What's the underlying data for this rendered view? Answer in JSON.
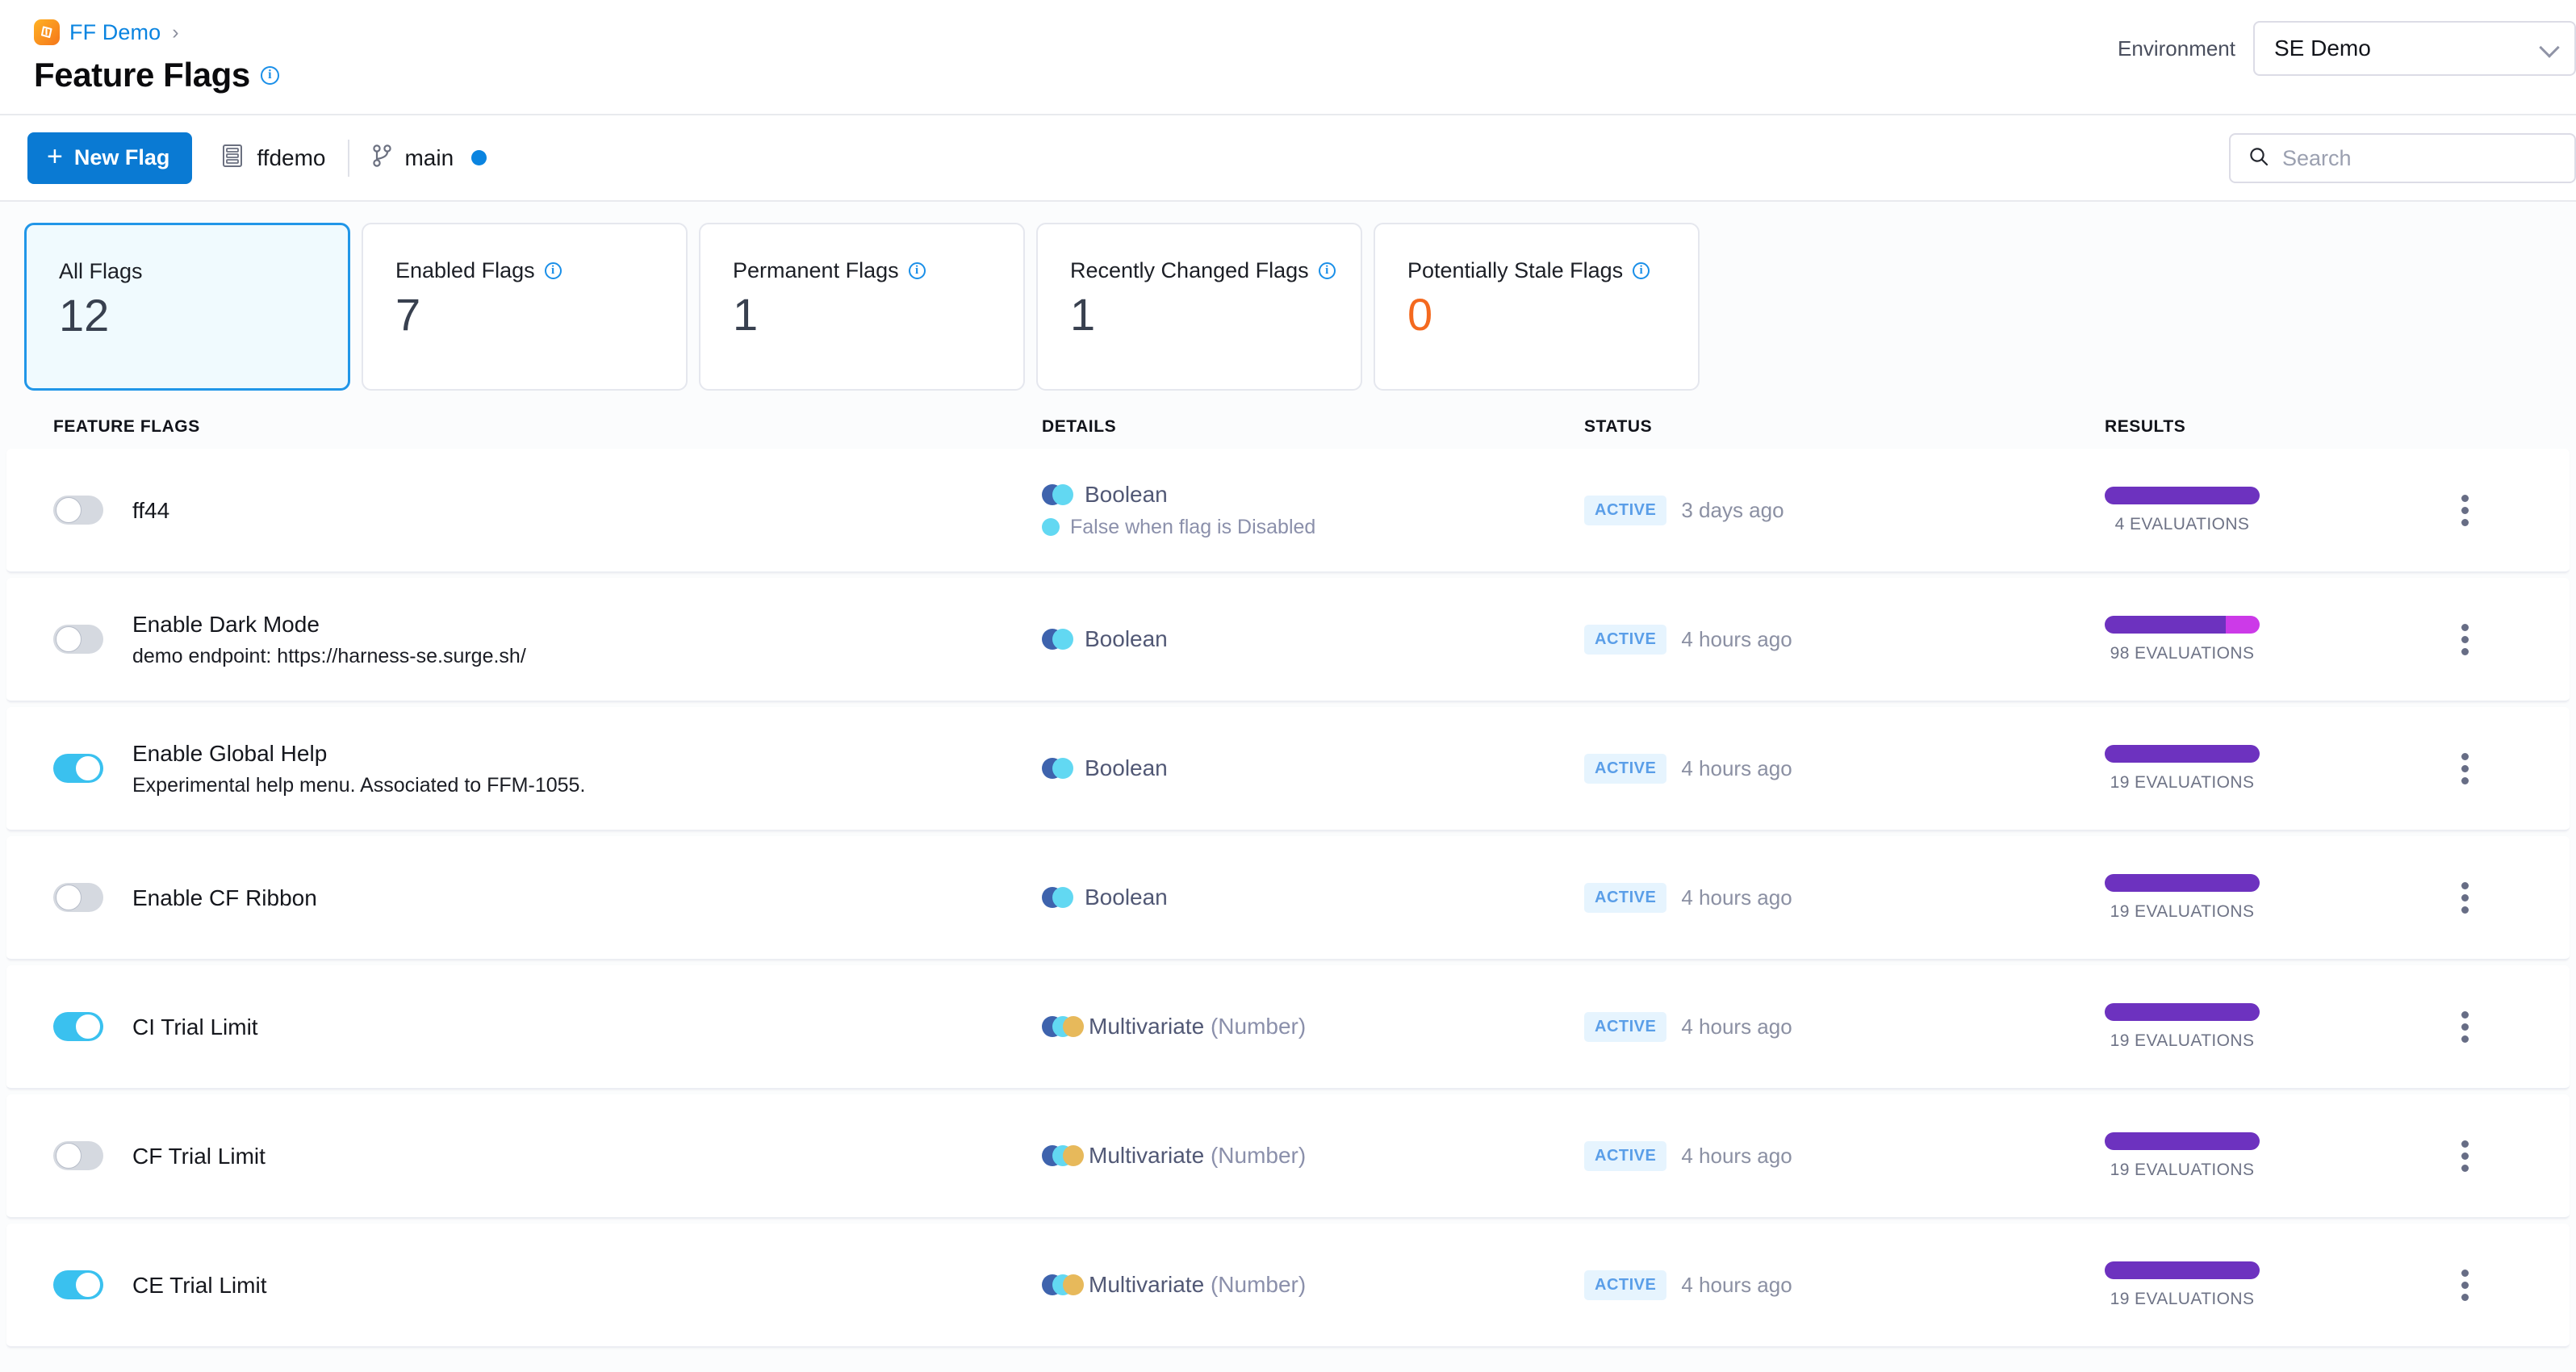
{
  "header": {
    "breadcrumb": {
      "logo_icon": "harness-logo-icon",
      "project": "FF Demo",
      "separator": "›"
    },
    "page_title": "Feature Flags",
    "page_title_info_icon": "info-icon",
    "environment_label": "Environment",
    "environment_value": "SE Demo",
    "environment_chevron_icon": "chevron-down-icon"
  },
  "toolbar": {
    "new_flag_label": "New Flag",
    "new_flag_plus_icon": "plus-icon",
    "repo_icon": "repository-icon",
    "repo_name": "ffdemo",
    "branch_icon": "git-branch-icon",
    "branch_name": "main",
    "branch_status_dot": "blue-dot-icon",
    "search_icon": "search-icon",
    "search_value": "",
    "search_placeholder": "Search"
  },
  "cards": [
    {
      "label": "All Flags",
      "value": "12",
      "active": true,
      "info": false
    },
    {
      "label": "Enabled Flags",
      "value": "7",
      "active": false,
      "info": true
    },
    {
      "label": "Permanent Flags",
      "value": "1",
      "active": false,
      "info": true
    },
    {
      "label": "Recently Changed Flags",
      "value": "1",
      "active": false,
      "info": true
    },
    {
      "label": "Potentially Stale Flags",
      "value": "0",
      "active": false,
      "info": true,
      "value_color": "#f4691f"
    }
  ],
  "table": {
    "headers": {
      "flags": "FEATURE FLAGS",
      "details": "DETAILS",
      "status": "STATUS",
      "results": "RESULTS"
    },
    "kebab_icon": "more-options-icon",
    "rows": [
      {
        "enabled": false,
        "name": "ff44",
        "desc": "",
        "kind": "Boolean",
        "kind_paren": "",
        "kind_icon": "boolean-variation-icon",
        "sub_text": "False when flag is Disabled",
        "status": "ACTIVE",
        "ago": "3 days ago",
        "evaluations": "4 EVALUATIONS",
        "bar": [
          {
            "color": "#6d32bf",
            "pct": 100
          }
        ]
      },
      {
        "enabled": false,
        "name": "Enable Dark Mode",
        "desc": "demo endpoint: https://harness-se.surge.sh/",
        "kind": "Boolean",
        "kind_paren": "",
        "kind_icon": "boolean-variation-icon",
        "sub_text": "",
        "status": "ACTIVE",
        "ago": "4 hours ago",
        "evaluations": "98 EVALUATIONS",
        "bar": [
          {
            "color": "#6d32bf",
            "pct": 78
          },
          {
            "color": "#cc3ae8",
            "pct": 22
          }
        ]
      },
      {
        "enabled": true,
        "name": "Enable Global Help",
        "desc": "Experimental help menu. Associated to FFM-1055.",
        "kind": "Boolean",
        "kind_paren": "",
        "kind_icon": "boolean-variation-icon",
        "sub_text": "",
        "status": "ACTIVE",
        "ago": "4 hours ago",
        "evaluations": "19 EVALUATIONS",
        "bar": [
          {
            "color": "#6d32bf",
            "pct": 100
          }
        ]
      },
      {
        "enabled": false,
        "name": "Enable CF Ribbon",
        "desc": "",
        "kind": "Boolean",
        "kind_paren": "",
        "kind_icon": "boolean-variation-icon",
        "sub_text": "",
        "status": "ACTIVE",
        "ago": "4 hours ago",
        "evaluations": "19 EVALUATIONS",
        "bar": [
          {
            "color": "#6d32bf",
            "pct": 100
          }
        ]
      },
      {
        "enabled": true,
        "name": "CI Trial Limit",
        "desc": "",
        "kind": "Multivariate",
        "kind_paren": "(Number)",
        "kind_icon": "multivariate-variation-icon",
        "sub_text": "",
        "status": "ACTIVE",
        "ago": "4 hours ago",
        "evaluations": "19 EVALUATIONS",
        "bar": [
          {
            "color": "#6d32bf",
            "pct": 100
          }
        ]
      },
      {
        "enabled": false,
        "name": "CF Trial Limit",
        "desc": "",
        "kind": "Multivariate",
        "kind_paren": "(Number)",
        "kind_icon": "multivariate-variation-icon",
        "sub_text": "",
        "status": "ACTIVE",
        "ago": "4 hours ago",
        "evaluations": "19 EVALUATIONS",
        "bar": [
          {
            "color": "#6d32bf",
            "pct": 100
          }
        ]
      },
      {
        "enabled": true,
        "name": "CE Trial Limit",
        "desc": "",
        "kind": "Multivariate",
        "kind_paren": "(Number)",
        "kind_icon": "multivariate-variation-icon",
        "sub_text": "",
        "status": "ACTIVE",
        "ago": "4 hours ago",
        "evaluations": "19 EVALUATIONS",
        "bar": [
          {
            "color": "#6d32bf",
            "pct": 100
          }
        ]
      }
    ]
  },
  "colors": {
    "accent_blue": "#0a7ad3",
    "link_blue": "#0a84e0",
    "toggle_on": "#3ac1ef",
    "purple": "#6d32bf",
    "magenta": "#cc3ae8",
    "orange": "#f4691f",
    "badge_bg": "#e6f4fe",
    "badge_text": "#5a9ee8"
  }
}
